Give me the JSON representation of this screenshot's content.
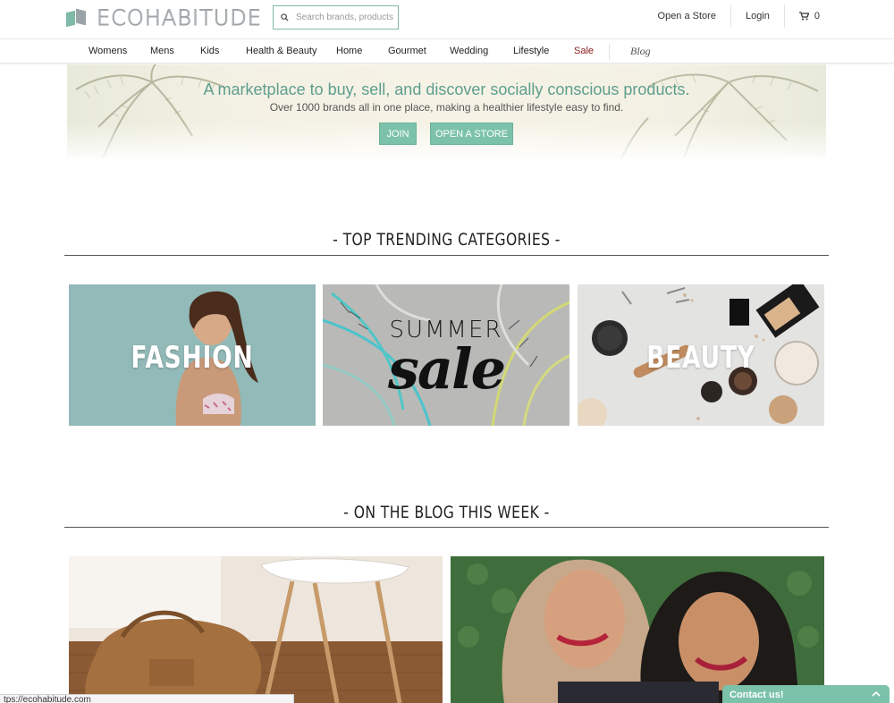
{
  "header": {
    "logo_text": "ECOHABITUDE",
    "search_placeholder": "Search brands, products",
    "open_store": "Open a Store",
    "login": "Login",
    "cart_count": "0"
  },
  "nav": {
    "items": [
      "Womens",
      "Mens",
      "Kids",
      "Health & Beauty",
      "Home",
      "Gourmet",
      "Wedding",
      "Lifestyle",
      "Sale"
    ],
    "blog": "Blog"
  },
  "hero": {
    "title": "A marketplace to buy, sell, and discover socially conscious products.",
    "subtitle": "Over 1000 brands all in one place, making a healthier lifestyle easy to find.",
    "join_label": "JOIN",
    "open_store_label": "OPEN A STORE"
  },
  "trending": {
    "title": "- TOP TRENDING CATEGORIES -",
    "tiles": [
      {
        "label": "FASHION"
      },
      {
        "label_top": "SUMMER",
        "label_script": "sale"
      },
      {
        "label": "BEAUTY"
      }
    ]
  },
  "blog_section": {
    "title": "- ON THE BLOG THIS WEEK -"
  },
  "status_bar": {
    "url": "tps://ecohabitude.com"
  },
  "contact": {
    "label": "Contact us!"
  },
  "colors": {
    "accent": "#7cc2ab",
    "accent_text": "#5e9e8e",
    "sale": "#8a1a1a"
  }
}
